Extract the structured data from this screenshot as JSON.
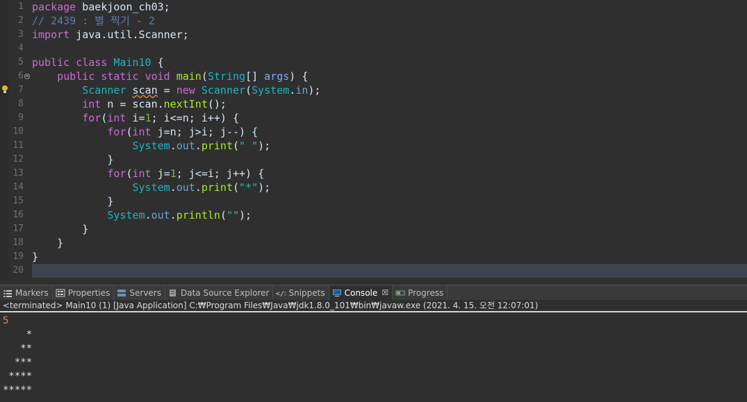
{
  "editor": {
    "line_numbers": [
      "1",
      "2",
      "3",
      "4",
      "5",
      "6",
      "7",
      "8",
      "9",
      "10",
      "11",
      "12",
      "13",
      "14",
      "15",
      "16",
      "17",
      "18",
      "19",
      "20"
    ],
    "lines": [
      [
        {
          "t": "package ",
          "c": "kw"
        },
        {
          "t": "baekjoon_ch03;",
          "c": ""
        }
      ],
      [
        {
          "t": "// 2439 : 별 찍기 - 2",
          "c": "cmt"
        }
      ],
      [
        {
          "t": "import ",
          "c": "kw"
        },
        {
          "t": "java.util.Scanner;",
          "c": ""
        }
      ],
      [],
      [
        {
          "t": "public ",
          "c": "kw"
        },
        {
          "t": "class ",
          "c": "kw"
        },
        {
          "t": "Main10",
          "c": "typ"
        },
        {
          "t": " {",
          "c": ""
        }
      ],
      [
        {
          "t": "    ",
          "c": ""
        },
        {
          "t": "public ",
          "c": "kw"
        },
        {
          "t": "static ",
          "c": "kw"
        },
        {
          "t": "void ",
          "c": "kw"
        },
        {
          "t": "main",
          "c": "mth"
        },
        {
          "t": "(",
          "c": ""
        },
        {
          "t": "String",
          "c": "typ"
        },
        {
          "t": "[] ",
          "c": ""
        },
        {
          "t": "args",
          "c": "var"
        },
        {
          "t": ") {",
          "c": ""
        }
      ],
      [
        {
          "t": "        ",
          "c": ""
        },
        {
          "t": "Scanner",
          "c": "typ"
        },
        {
          "t": " ",
          "c": ""
        },
        {
          "t": "scan",
          "c": "warn"
        },
        {
          "t": " = ",
          "c": ""
        },
        {
          "t": "new ",
          "c": "kw"
        },
        {
          "t": "Scanner",
          "c": "typ"
        },
        {
          "t": "(",
          "c": ""
        },
        {
          "t": "System",
          "c": "typ"
        },
        {
          "t": ".",
          "c": ""
        },
        {
          "t": "in",
          "c": "fld"
        },
        {
          "t": ");",
          "c": ""
        }
      ],
      [
        {
          "t": "        ",
          "c": ""
        },
        {
          "t": "int ",
          "c": "kw"
        },
        {
          "t": "n = scan.",
          "c": ""
        },
        {
          "t": "nextInt",
          "c": "mth"
        },
        {
          "t": "();",
          "c": ""
        }
      ],
      [
        {
          "t": "        ",
          "c": ""
        },
        {
          "t": "for",
          "c": "kw"
        },
        {
          "t": "(",
          "c": ""
        },
        {
          "t": "int ",
          "c": "kw"
        },
        {
          "t": "i=",
          "c": ""
        },
        {
          "t": "1",
          "c": "num"
        },
        {
          "t": "; i<=n; i++) {",
          "c": ""
        }
      ],
      [
        {
          "t": "            ",
          "c": ""
        },
        {
          "t": "for",
          "c": "kw"
        },
        {
          "t": "(",
          "c": ""
        },
        {
          "t": "int ",
          "c": "kw"
        },
        {
          "t": "j=n; j>i; j--) {",
          "c": ""
        }
      ],
      [
        {
          "t": "                ",
          "c": ""
        },
        {
          "t": "System",
          "c": "typ"
        },
        {
          "t": ".",
          "c": ""
        },
        {
          "t": "out",
          "c": "fld"
        },
        {
          "t": ".",
          "c": ""
        },
        {
          "t": "print",
          "c": "mth"
        },
        {
          "t": "(",
          "c": ""
        },
        {
          "t": "\" \"",
          "c": "str"
        },
        {
          "t": ");",
          "c": ""
        }
      ],
      [
        {
          "t": "            }",
          "c": ""
        }
      ],
      [
        {
          "t": "            ",
          "c": ""
        },
        {
          "t": "for",
          "c": "kw"
        },
        {
          "t": "(",
          "c": ""
        },
        {
          "t": "int ",
          "c": "kw"
        },
        {
          "t": "j=",
          "c": ""
        },
        {
          "t": "1",
          "c": "num"
        },
        {
          "t": "; j<=i; j++) {",
          "c": ""
        }
      ],
      [
        {
          "t": "                ",
          "c": ""
        },
        {
          "t": "System",
          "c": "typ"
        },
        {
          "t": ".",
          "c": ""
        },
        {
          "t": "out",
          "c": "fld"
        },
        {
          "t": ".",
          "c": ""
        },
        {
          "t": "print",
          "c": "mth"
        },
        {
          "t": "(",
          "c": ""
        },
        {
          "t": "\"*\"",
          "c": "str"
        },
        {
          "t": ");",
          "c": ""
        }
      ],
      [
        {
          "t": "            }",
          "c": ""
        }
      ],
      [
        {
          "t": "            ",
          "c": ""
        },
        {
          "t": "System",
          "c": "typ"
        },
        {
          "t": ".",
          "c": ""
        },
        {
          "t": "out",
          "c": "fld"
        },
        {
          "t": ".",
          "c": ""
        },
        {
          "t": "println",
          "c": "mth"
        },
        {
          "t": "(",
          "c": ""
        },
        {
          "t": "\"\"",
          "c": "str"
        },
        {
          "t": ");",
          "c": ""
        }
      ],
      [
        {
          "t": "        }",
          "c": ""
        }
      ],
      [
        {
          "t": "    }",
          "c": ""
        }
      ],
      [
        {
          "t": "}",
          "c": ""
        }
      ],
      []
    ]
  },
  "panel": {
    "tabs": [
      {
        "label": "Markers",
        "icon": "markers-icon",
        "active": false
      },
      {
        "label": "Properties",
        "icon": "properties-icon",
        "active": false
      },
      {
        "label": "Servers",
        "icon": "servers-icon",
        "active": false
      },
      {
        "label": "Data Source Explorer",
        "icon": "data-source-icon",
        "active": false
      },
      {
        "label": "Snippets",
        "icon": "snippets-icon",
        "active": false
      },
      {
        "label": "Console",
        "icon": "console-icon",
        "active": true
      },
      {
        "label": "Progress",
        "icon": "progress-icon",
        "active": false
      }
    ],
    "close_glyph": "☒",
    "status": "<terminated> Main10 (1) [Java Application] C:₩Program Files₩Java₩jdk1.8.0_101₩bin₩javaw.exe (2021. 4. 15. 오전 12:07:01)"
  },
  "console": {
    "input": "5",
    "output": [
      "    *",
      "   **",
      "  ***",
      " ****",
      "*****"
    ]
  },
  "colors": {
    "background": "#2f2f2f",
    "keyword": "#cc6cd4",
    "type": "#1eb5c4",
    "method": "#a7ec21",
    "string": "#17c6a3",
    "comment": "#5d7bb0",
    "active_line": "#3e4450"
  }
}
